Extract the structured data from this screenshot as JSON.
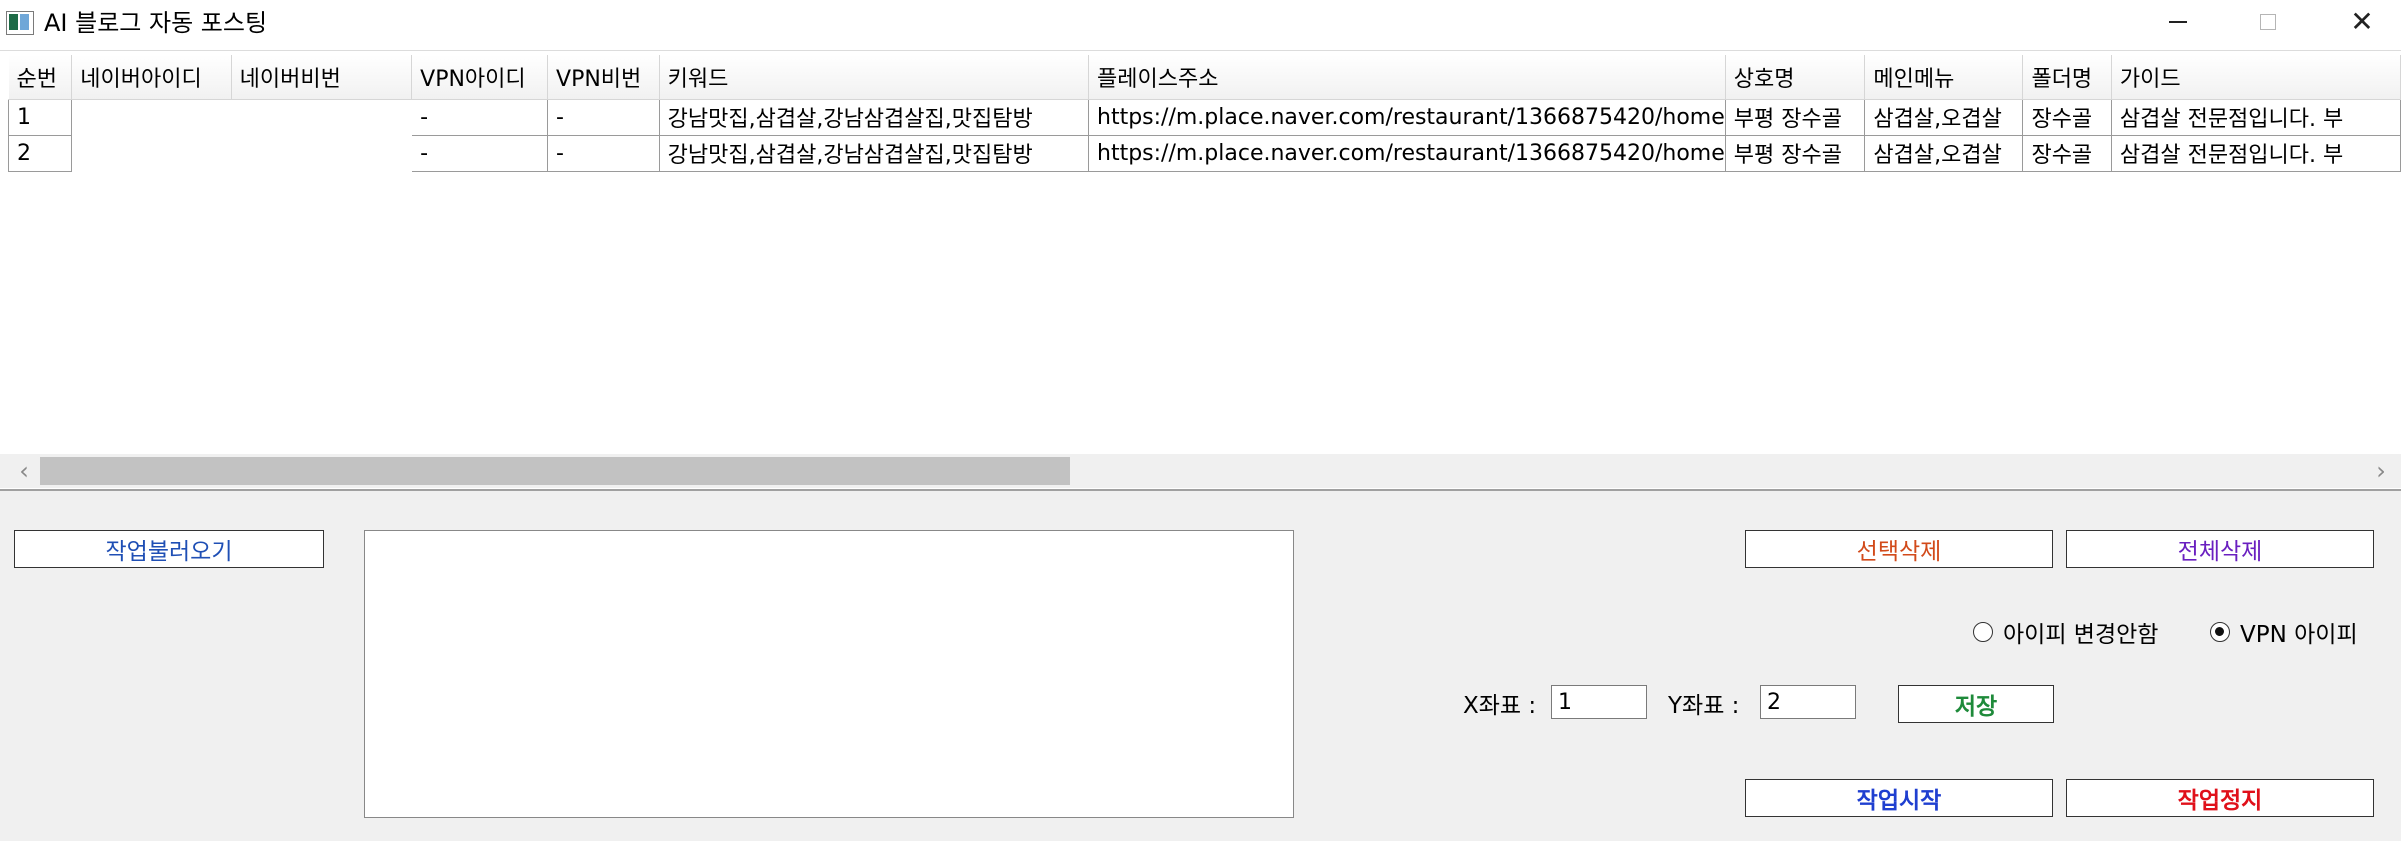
{
  "window": {
    "title": "AI 블로그 자동 포스팅"
  },
  "table": {
    "columns": [
      "순번",
      "네이버아이디",
      "네이버비번",
      "VPN아이디",
      "VPN비번",
      "키워드",
      "플레이스주소",
      "상호명",
      "메인메뉴",
      "폴더명",
      "가이드"
    ],
    "rows": [
      [
        "1",
        "",
        "",
        "-",
        "-",
        "강남맛집,삼겹살,강남삼겹살집,맛집탐방",
        "https://m.place.naver.com/restaurant/1366875420/home",
        "부평 장수골",
        "삼겹살,오겹살",
        "장수골",
        "삼겹살 전문점입니다. 부"
      ],
      [
        "2",
        "",
        "",
        "-",
        "-",
        "강남맛집,삼겹살,강남삼겹살집,맛집탐방",
        "https://m.place.naver.com/restaurant/1366875420/home",
        "부평 장수골",
        "삼겹살,오겹살",
        "장수골",
        "삼겹살 전문점입니다. 부"
      ]
    ]
  },
  "buttons": {
    "load_job": "작업불러오기",
    "delete_selected": "선택삭제",
    "delete_all": "전체삭제",
    "save": "저장",
    "start_job": "작업시작",
    "stop_job": "작업정지"
  },
  "radio": {
    "no_ip_change": "아이피 변경안함",
    "vpn_ip": "VPN 아이피",
    "selected": "vpn_ip"
  },
  "coords": {
    "x_label": "X좌표 :",
    "x_value": "1",
    "y_label": "Y좌표 :",
    "y_value": "2"
  },
  "colors": {
    "load_job": "#1f4fb5",
    "delete_selected": "#d24a1a",
    "delete_all": "#6a1fc0",
    "save": "#1e8a3a",
    "start_job": "#1f3fd0",
    "stop_job": "#e0101a"
  },
  "icons": [
    "app-icon",
    "minimize-icon",
    "maximize-icon",
    "close-icon",
    "scroll-left-icon",
    "scroll-right-icon"
  ]
}
